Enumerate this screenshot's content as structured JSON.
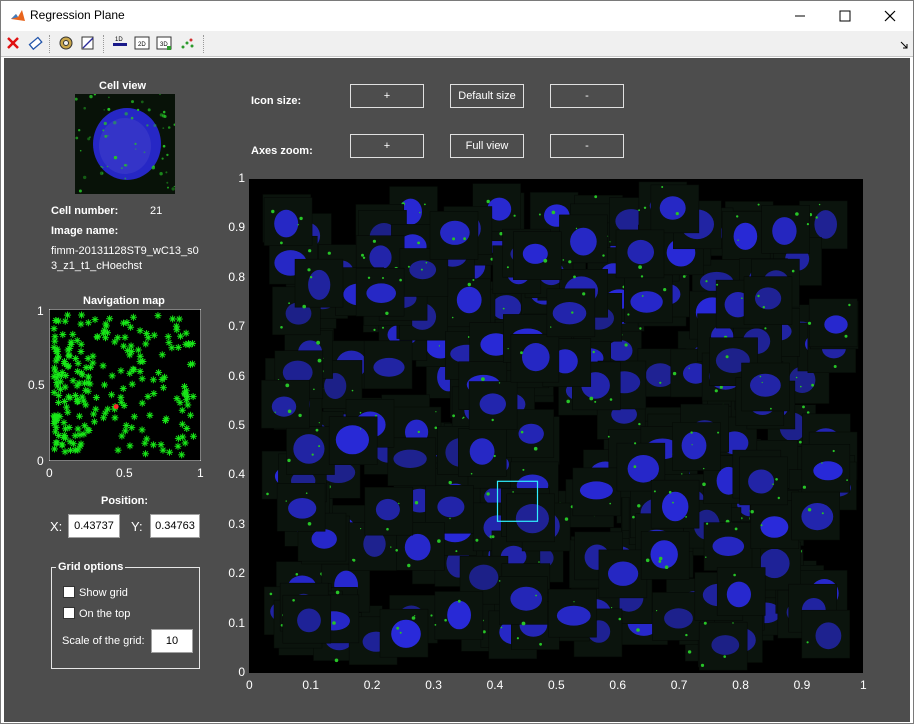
{
  "window": {
    "title": "Regression Plane"
  },
  "toolbar": {
    "icons": [
      "close-x-icon",
      "eraser-icon",
      "gear-icon",
      "export-icon",
      "label-1d-icon",
      "label-2d-icon",
      "label-3d-icon",
      "scatter-icon"
    ]
  },
  "left": {
    "cell_view_title": "Cell view",
    "cell_number_label": "Cell number:",
    "cell_number_value": "21",
    "image_name_label": "Image name:",
    "image_name_line1": "fimm-20131128ST9_wC13_s0",
    "image_name_line2": "3_z1_t1_cHoechst",
    "nav_map_title": "Navigation map",
    "nav_yticks": [
      "1",
      "0.5",
      "0"
    ],
    "nav_xticks": [
      "0",
      "0.5",
      "1"
    ],
    "position_title": "Position:",
    "x_label": "X:",
    "x_value": "0.43737",
    "y_label": "Y:",
    "y_value": "0.34763"
  },
  "grid_options": {
    "title": "Grid options",
    "show_grid": "Show grid",
    "on_top": "On the top",
    "scale_label": "Scale of the grid:",
    "scale_value": "10"
  },
  "controls": {
    "icon_size_label": "Icon size:",
    "axes_zoom_label": "Axes zoom:",
    "plus": "+",
    "minus": "-",
    "default_size": "Default size",
    "full_view": "Full view"
  },
  "main_plot": {
    "yticks": [
      "1",
      "0.9",
      "0.8",
      "0.7",
      "0.6",
      "0.5",
      "0.4",
      "0.3",
      "0.2",
      "0.1",
      "0"
    ],
    "xticks": [
      "0",
      "0.1",
      "0.2",
      "0.3",
      "0.4",
      "0.5",
      "0.6",
      "0.7",
      "0.8",
      "0.9",
      "1"
    ],
    "selected": {
      "x": 0.43737,
      "y": 0.34763
    }
  },
  "colors": {
    "cell_blue": "#2b2be6",
    "speck_green": "#27c427",
    "marker_green": "#18e818",
    "highlight": "#2ff0ff"
  }
}
